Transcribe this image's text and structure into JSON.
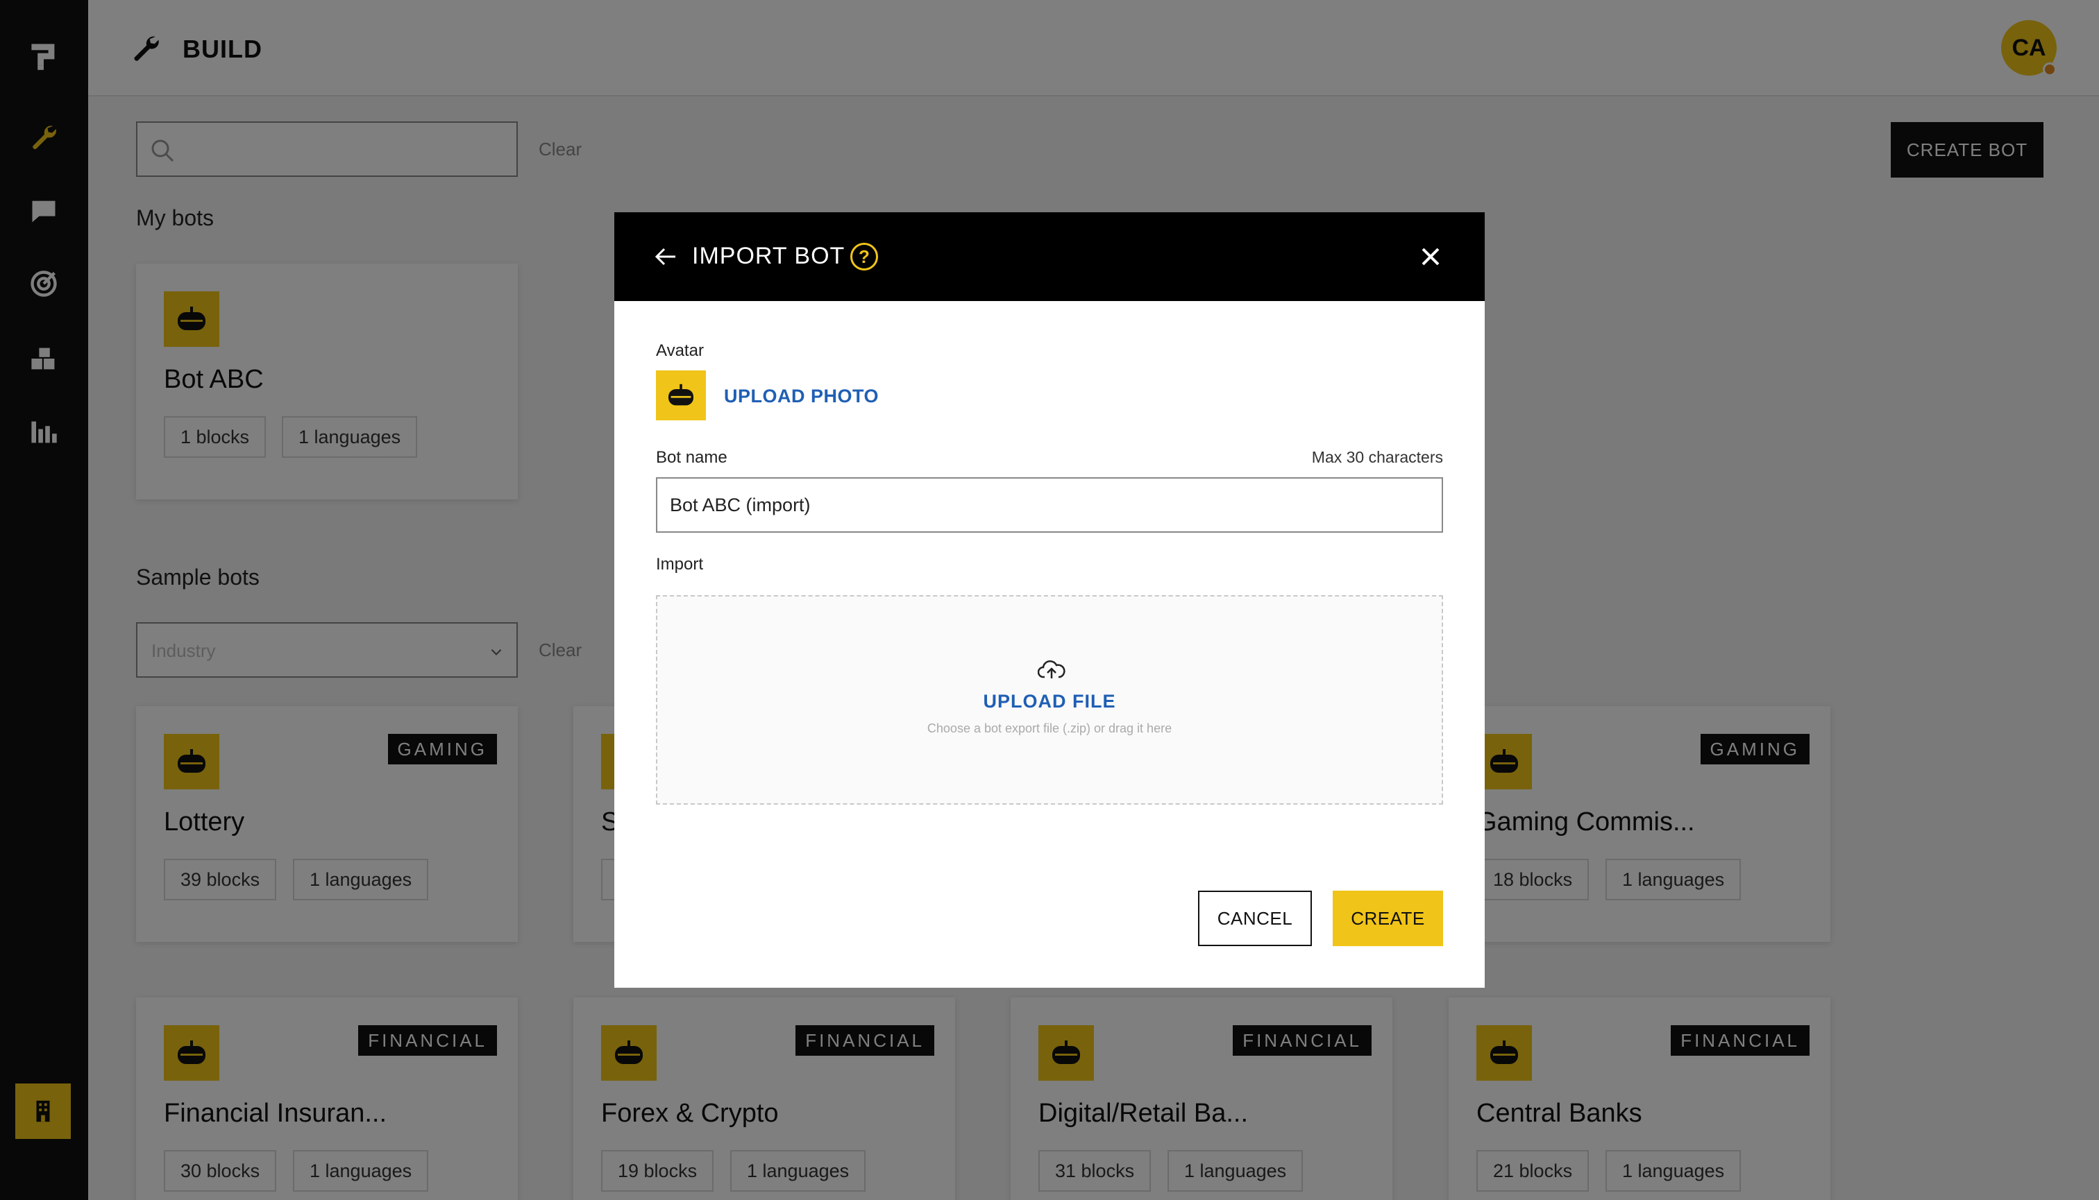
{
  "sidebar": {
    "icons": [
      "logo-icon",
      "wrench-icon",
      "chat-icon",
      "target-icon",
      "blocks-icon",
      "bar-chart-icon",
      "building-icon"
    ]
  },
  "header": {
    "title": "BUILD",
    "user_initials": "CA"
  },
  "toolbar": {
    "search_value": "",
    "clear_label": "Clear",
    "create_bot_label": "CREATE BOT"
  },
  "my_bots": {
    "title": "My bots",
    "items": [
      {
        "name": "Bot ABC",
        "blocks": "1 blocks",
        "languages": "1 languages"
      }
    ]
  },
  "sample_bots": {
    "title": "Sample bots",
    "industry_placeholder": "Industry",
    "clear_label": "Clear",
    "row1": [
      {
        "name": "Lottery",
        "tag": "GAMING",
        "blocks": "39 blocks",
        "languages": "1 languages"
      },
      {
        "name": "S",
        "tag": "",
        "blocks": "",
        "languages": ""
      },
      {
        "name": "Gaming Commis...",
        "tag": "GAMING",
        "blocks": "18 blocks",
        "languages": "1 languages"
      }
    ],
    "row2": [
      {
        "name": "Financial Insuran...",
        "tag": "FINANCIAL",
        "blocks": "30 blocks",
        "languages": "1 languages"
      },
      {
        "name": "Forex & Crypto",
        "tag": "FINANCIAL",
        "blocks": "19 blocks",
        "languages": "1 languages"
      },
      {
        "name": "Digital/Retail Ba...",
        "tag": "FINANCIAL",
        "blocks": "31 blocks",
        "languages": "1 languages"
      },
      {
        "name": "Central Banks",
        "tag": "FINANCIAL",
        "blocks": "21 blocks",
        "languages": "1 languages"
      }
    ]
  },
  "modal": {
    "title": "IMPORT BOT",
    "help": "?",
    "avatar_label": "Avatar",
    "upload_photo_label": "UPLOAD PHOTO",
    "bot_name_label": "Bot name",
    "max_chars": "Max 30 characters",
    "bot_name_value": "Bot ABC (import)",
    "import_label": "Import",
    "upload_file_label": "UPLOAD FILE",
    "upload_hint": "Choose a bot export file (.zip) or drag it here",
    "cancel_label": "CANCEL",
    "create_label": "CREATE"
  },
  "colors": {
    "accent": "#f0c419",
    "link": "#1f5fb4",
    "sidebar": "#111111"
  }
}
